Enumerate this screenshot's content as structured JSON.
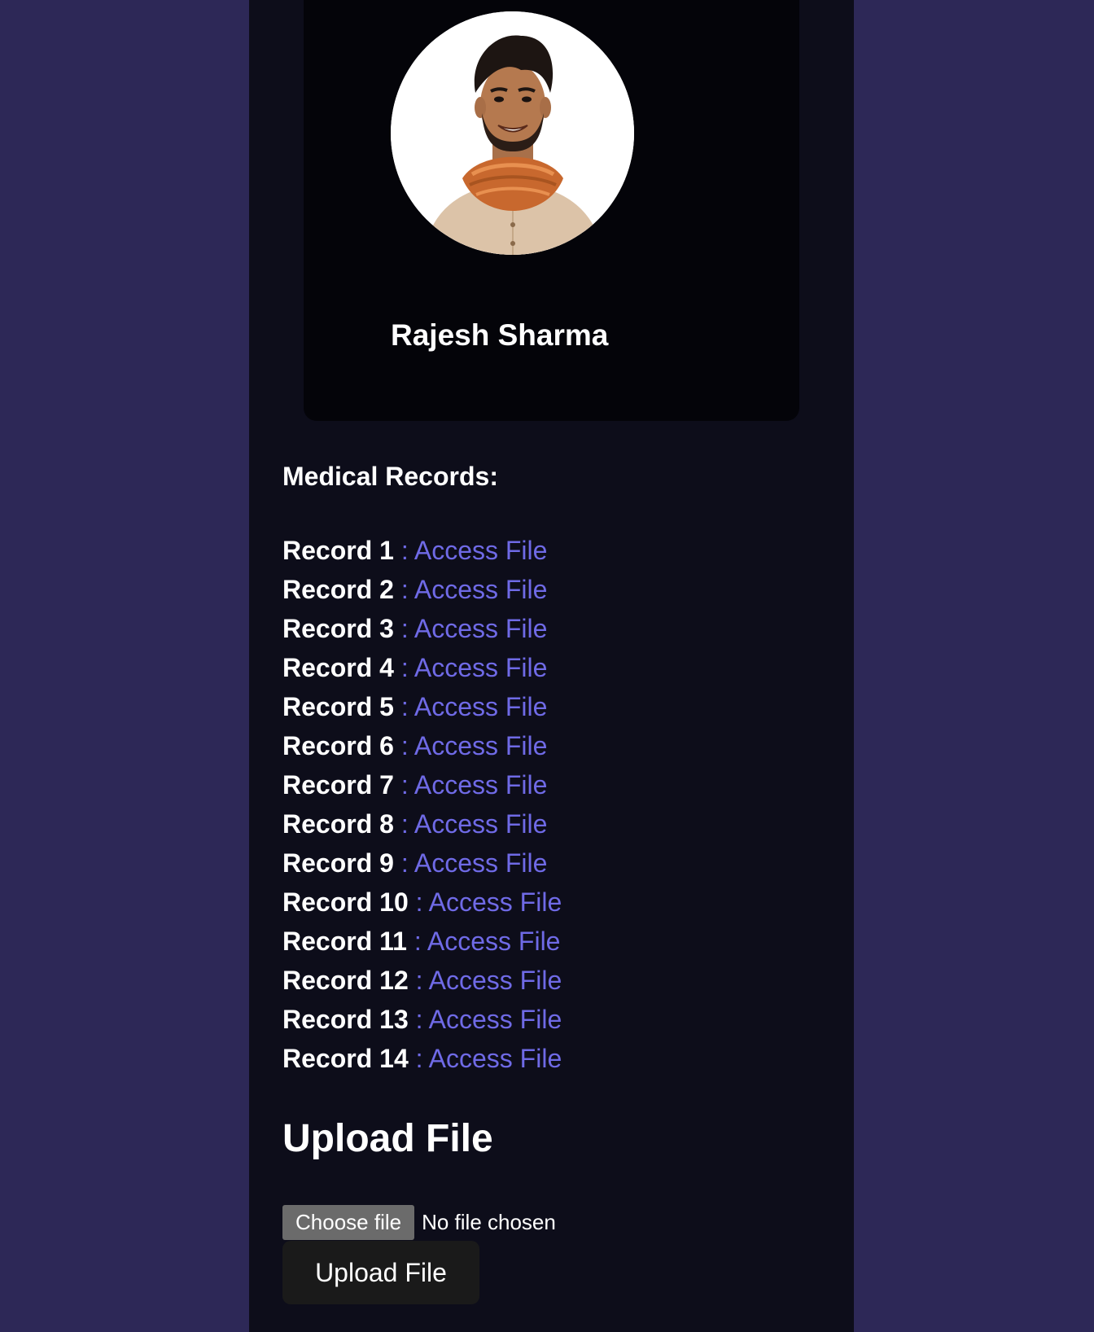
{
  "profile": {
    "name": "Rajesh Sharma",
    "avatar_icon": "avatar-photo"
  },
  "records": {
    "heading": "Medical Records:",
    "items": [
      {
        "label": "Record 1",
        "link": ": Access File"
      },
      {
        "label": "Record 2",
        "link": ": Access File"
      },
      {
        "label": "Record 3",
        "link": ": Access File"
      },
      {
        "label": "Record 4",
        "link": ": Access File"
      },
      {
        "label": "Record 5",
        "link": ": Access File"
      },
      {
        "label": "Record 6",
        "link": ": Access File"
      },
      {
        "label": "Record 7",
        "link": ": Access File"
      },
      {
        "label": "Record 8",
        "link": ": Access File"
      },
      {
        "label": "Record 9",
        "link": ": Access File"
      },
      {
        "label": "Record 10",
        "link": ": Access File"
      },
      {
        "label": "Record 11",
        "link": ": Access File"
      },
      {
        "label": "Record 12",
        "link": ": Access File"
      },
      {
        "label": "Record 13",
        "link": ": Access File"
      },
      {
        "label": "Record 14",
        "link": ": Access File"
      }
    ]
  },
  "upload": {
    "heading": "Upload File",
    "choose_label": "Choose file",
    "file_status": "No file chosen",
    "submit_label": "Upload File"
  },
  "colors": {
    "page_background": "#2d2857",
    "panel_background": "#0d0d1a",
    "card_background": "#040409",
    "link": "#6f6ae6",
    "text": "#ffffff"
  }
}
